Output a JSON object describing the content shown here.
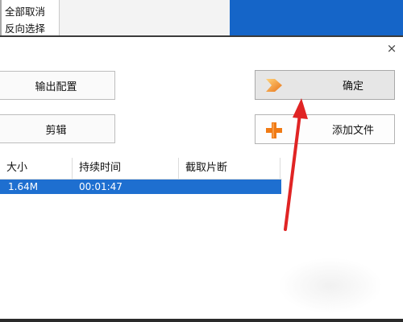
{
  "context_menu": {
    "items": [
      {
        "label": "全部取消"
      },
      {
        "label": "反向选择"
      }
    ]
  },
  "dialog": {
    "close_glyph": "×",
    "buttons": {
      "export_config": "输出配置",
      "edit": "剪辑",
      "confirm": "确定",
      "add_file": "添加文件"
    },
    "icons": {
      "confirm": "arrow-right-icon",
      "add_file": "plus-icon"
    },
    "table": {
      "columns": [
        "大小",
        "持续时间",
        "截取片断"
      ],
      "rows": [
        {
          "size": "1.64M",
          "duration": "00:01:47",
          "clip": ""
        }
      ]
    }
  },
  "colors": {
    "selection": "#1e6fd0",
    "top_panel": "#1565c8",
    "annotation_arrow": "#e02424",
    "confirm_icon": "#f08a1c",
    "add_icon": "#f07a14"
  }
}
